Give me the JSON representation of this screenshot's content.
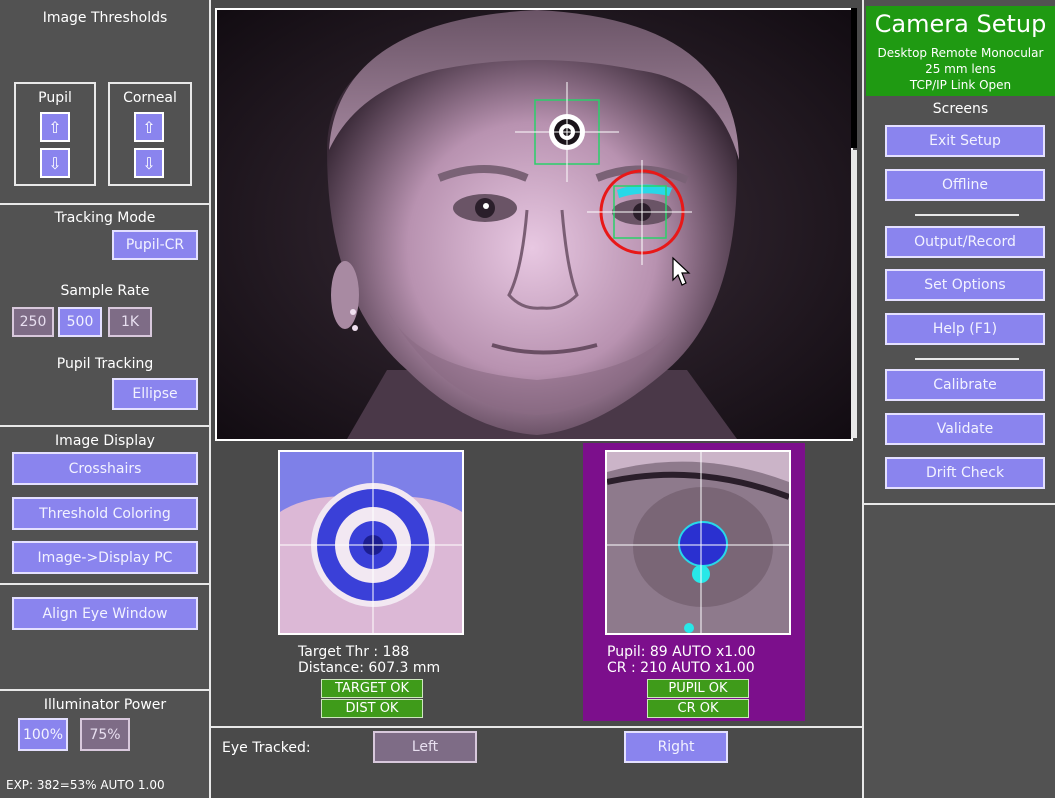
{
  "thresholds": {
    "title": "Image Thresholds",
    "pupil_label": "Pupil",
    "corneal_label": "Corneal",
    "up_glyph": "⇧",
    "down_glyph": "⇩"
  },
  "tracking": {
    "mode_title": "Tracking Mode",
    "mode_value": "Pupil-CR",
    "rate_title": "Sample Rate",
    "rates": [
      "250",
      "500",
      "1K"
    ],
    "selected_rate": "500",
    "pupil_title": "Pupil Tracking",
    "pupil_value": "Ellipse"
  },
  "image_display": {
    "title": "Image Display",
    "crosshairs": "Crosshairs",
    "threshold_coloring": "Threshold Coloring",
    "image_display_pc": "Image->Display PC"
  },
  "align": {
    "label": "Align Eye Window"
  },
  "illuminator": {
    "title": "Illuminator Power",
    "levels": [
      "100%",
      "75%"
    ],
    "selected": "100%",
    "exposure": "EXP: 382=53% AUTO 1.00"
  },
  "camera_setup": {
    "title": "Camera Setup",
    "line1": "Desktop Remote Monocular",
    "line2": "25 mm lens",
    "line3": "TCP/IP Link Open",
    "screens_title": "Screens",
    "buttons": [
      "Exit Setup",
      "Offline",
      "Output/Record",
      "Set Options",
      "Help (F1)",
      "Calibrate",
      "Validate",
      "Drift Check"
    ]
  },
  "target_panel": {
    "thr": "Target Thr : 188",
    "distance": "Distance: 607.3 mm",
    "status1": "TARGET OK",
    "status2": "DIST  OK"
  },
  "eye_panel": {
    "pupil": "Pupil:  89 AUTO x1.00",
    "cr": "CR   : 210 AUTO x1.00",
    "status1": "PUPIL OK",
    "status2": "CR  OK"
  },
  "eye_tracked": {
    "label": "Eye Tracked:",
    "left": "Left",
    "right": "Right",
    "selected": "Right"
  },
  "colors": {
    "button": "#8a84ee",
    "status_green": "#3f9b1a",
    "setup_green": "#1f9a12",
    "eye_panel_purple": "#7c0f8c"
  }
}
